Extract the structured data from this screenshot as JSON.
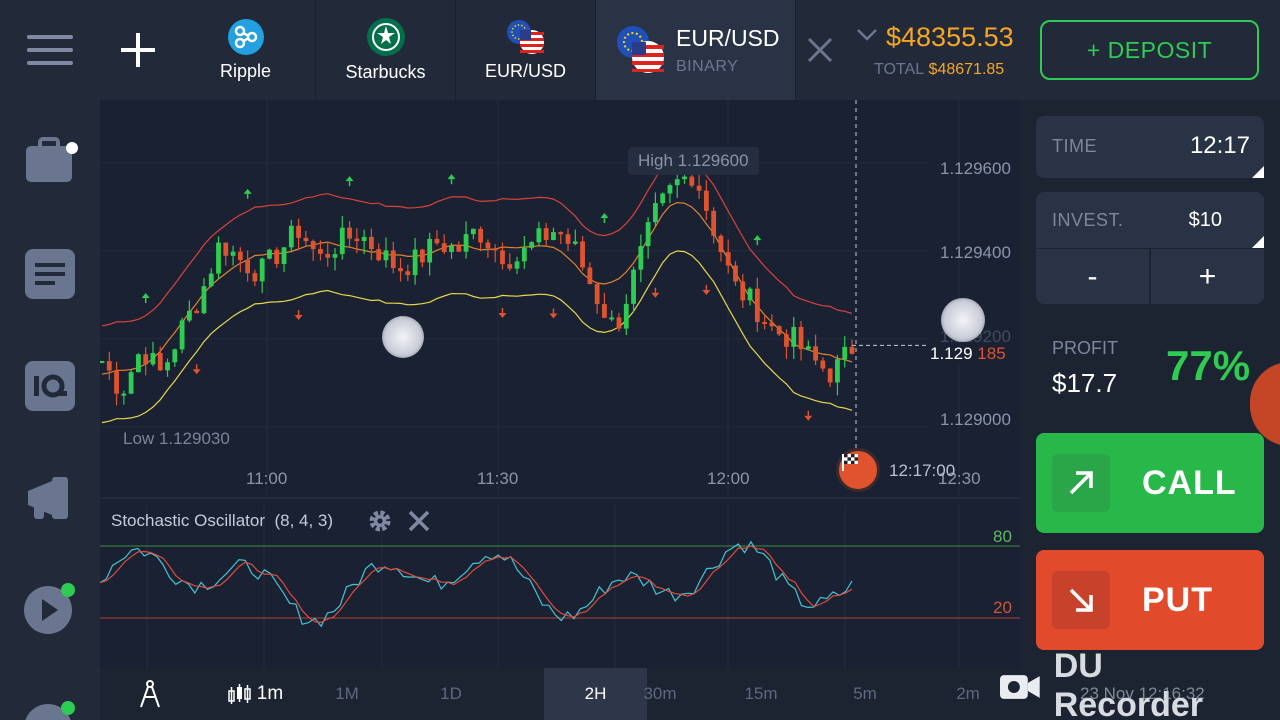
{
  "sidebar": {
    "items": [
      {
        "icon": "menu-icon"
      },
      {
        "icon": "portfolio-icon"
      },
      {
        "icon": "news-icon"
      },
      {
        "icon": "iq-icon"
      },
      {
        "icon": "promo-icon"
      },
      {
        "icon": "video-icon"
      },
      {
        "icon": "chat-icon"
      }
    ]
  },
  "tabs": {
    "add_icon": "plus-icon",
    "items": [
      {
        "label": "Ripple",
        "icon": "ripple-logo-icon"
      },
      {
        "label": "Starbucks",
        "icon": "starbucks-logo-icon"
      },
      {
        "label": "EUR/USD",
        "icon": "eur-usd-flags-icon"
      }
    ],
    "active": {
      "name": "EUR/USD",
      "type": "BINARY",
      "icon": "eur-usd-flags-icon"
    }
  },
  "balance": {
    "amount": "$48355.53",
    "total_label": "TOTAL",
    "total_value": "$48671.85"
  },
  "deposit_label": "+ DEPOSIT",
  "chart": {
    "high_label": "High  1.129600",
    "low_label": "Low  1.129030",
    "price_prefix": "1.129",
    "price_suffix": "185",
    "y_ticks": [
      "1.129600",
      "1.129400",
      "1.129200",
      "1.129000"
    ],
    "x_ticks": [
      "11:00",
      "11:30",
      "12:00",
      "12:30"
    ],
    "expiry_time": "12:17:00",
    "oscillator_title": "Stochastic  Oscillator",
    "oscillator_params": "(8,  4,  3)",
    "osc_levels": [
      "80",
      "20"
    ]
  },
  "bottombar": {
    "candle_period": "1m",
    "periods": [
      "1M",
      "1D",
      "2H",
      "30m",
      "15m",
      "5m",
      "2m"
    ],
    "selected_period": "2H"
  },
  "trade": {
    "time_label": "TIME",
    "time_value": "12:17",
    "invest_label": "INVEST.",
    "invest_value": "$10",
    "minus": "-",
    "plus": "+",
    "profit_label": "PROFIT",
    "profit_value": "$17.7",
    "profit_pct": "77%",
    "call_label": "CALL",
    "put_label": "PUT"
  },
  "watermark": {
    "text": "DU Recorder",
    "timestamp": "23 Nov 12:16:32"
  },
  "colors": {
    "up": "#2ecc52",
    "down": "#e0532f",
    "accent": "#f5a623",
    "bg": "#1c2331"
  },
  "chart_data": {
    "type": "candlestick",
    "instrument": "EUR/USD",
    "ylim": [
      1.12897,
      1.12972
    ],
    "y_ticks": [
      1.1296,
      1.1294,
      1.1292,
      1.129
    ],
    "x_ticks": [
      "11:00",
      "11:30",
      "12:00",
      "12:30"
    ],
    "high": 1.1296,
    "low": 1.12903,
    "current": 1.129185,
    "close_series": [
      1.12915,
      1.12908,
      1.12918,
      1.12912,
      1.12922,
      1.1293,
      1.12942,
      1.12938,
      1.12935,
      1.1294,
      1.12945,
      1.12938,
      1.12942,
      1.12944,
      1.1294,
      1.12936,
      1.12938,
      1.12942,
      1.1294,
      1.12945,
      1.1294,
      1.12938,
      1.12942,
      1.12945,
      1.1294,
      1.1293,
      1.12922,
      1.12935,
      1.12948,
      1.12955,
      1.12958,
      1.12945,
      1.12932,
      1.12928,
      1.12922,
      1.1292,
      1.12915,
      1.12912,
      1.12918
    ]
  }
}
